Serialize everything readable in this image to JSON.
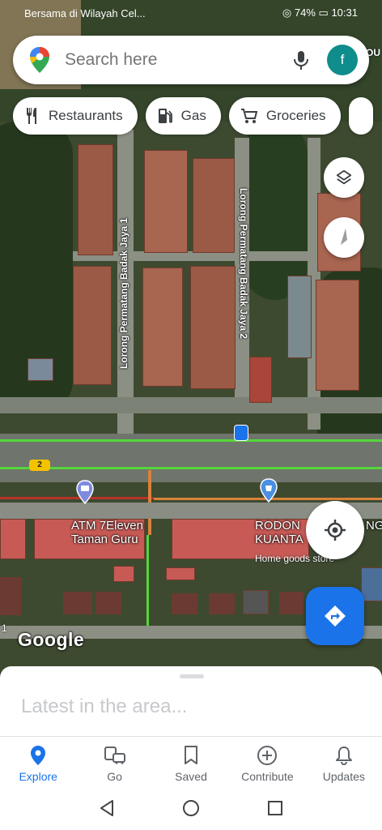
{
  "status_bar": {
    "carrier": "Bersama di Wilayah Cel...",
    "battery": "74%",
    "time": "10:31"
  },
  "search": {
    "placeholder": "Search here",
    "avatar_letter": "f"
  },
  "chips": [
    {
      "label": "Restaurants",
      "icon": "fork-knife-icon"
    },
    {
      "label": "Gas",
      "icon": "gas-pump-icon"
    },
    {
      "label": "Groceries",
      "icon": "cart-icon"
    }
  ],
  "map": {
    "street_1": "Lorong Permatang Badak Jaya 1",
    "street_2": "Lorong Permatang Badak Jaya 2",
    "route_shield": "2",
    "place_1_line1": "ATM 7Eleven",
    "place_1_line2": "Taman Guru",
    "place_2_line1": "RODON",
    "place_2_line1b": "NG",
    "place_2_line2": "KUANTA",
    "place_2_category": "Home goods store",
    "edge_label": "1",
    "corner_label": "OU",
    "google_logo": "Google"
  },
  "sheet": {
    "title": "Latest in the area..."
  },
  "bottom_nav": [
    {
      "label": "Explore",
      "active": true
    },
    {
      "label": "Go",
      "active": false
    },
    {
      "label": "Saved",
      "active": false
    },
    {
      "label": "Contribute",
      "active": false
    },
    {
      "label": "Updates",
      "active": false
    }
  ],
  "colors": {
    "accent": "#1a73e8",
    "avatar": "#0f8c8c",
    "traffic_green": "#55d63a"
  }
}
